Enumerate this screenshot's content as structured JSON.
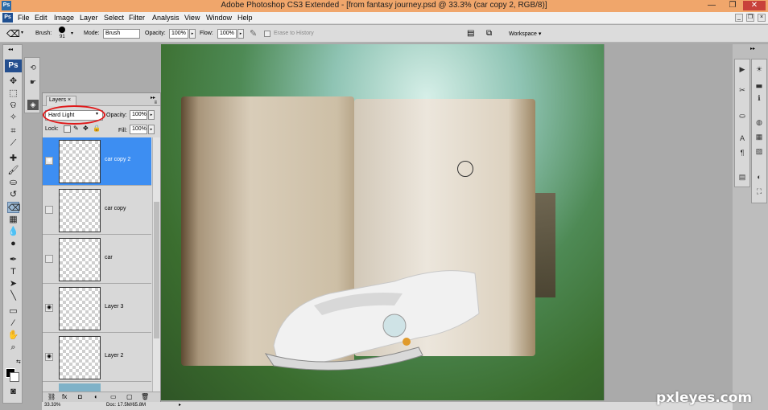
{
  "window": {
    "title": "Adobe Photoshop CS3 Extended - [from fantasy journey.psd @ 33.3% (car copy 2, RGB/8)]",
    "app_badge": "Ps"
  },
  "menu": [
    "File",
    "Edit",
    "Image",
    "Layer",
    "Select",
    "Filter",
    "Analysis",
    "View",
    "Window",
    "Help"
  ],
  "options": {
    "brush_label": "Brush:",
    "brush_size": "91",
    "mode_label": "Mode:",
    "mode_value": "Brush",
    "opacity_label": "Opacity:",
    "opacity_value": "100%",
    "flow_label": "Flow:",
    "flow_value": "100%",
    "erase_history": "Erase to History",
    "workspace": "Workspace ▾"
  },
  "toolbox": {
    "logo": "Ps"
  },
  "layers_panel": {
    "tab_label": "Layers ×",
    "blend_mode": "Hard Light",
    "opacity_label": "Opacity:",
    "opacity_value": "100%",
    "lock_label": "Lock:",
    "fill_label": "Fill:",
    "fill_value": "100%",
    "layers": [
      {
        "name": "car copy 2",
        "selected": true,
        "visible": true
      },
      {
        "name": "car copy",
        "selected": false,
        "visible": false
      },
      {
        "name": "car",
        "selected": false,
        "visible": false
      },
      {
        "name": "Layer 3",
        "selected": false,
        "visible": true
      },
      {
        "name": "Layer 2",
        "selected": false,
        "visible": true
      }
    ]
  },
  "status": {
    "zoom": "33.33%",
    "doc": "Doc: 17.5M/65.8M"
  },
  "watermark": "pxleyes.com",
  "colors": {
    "titlebar": "#f0a66b",
    "selected_layer": "#3d8ef2",
    "highlight_circle": "#e0191a"
  }
}
